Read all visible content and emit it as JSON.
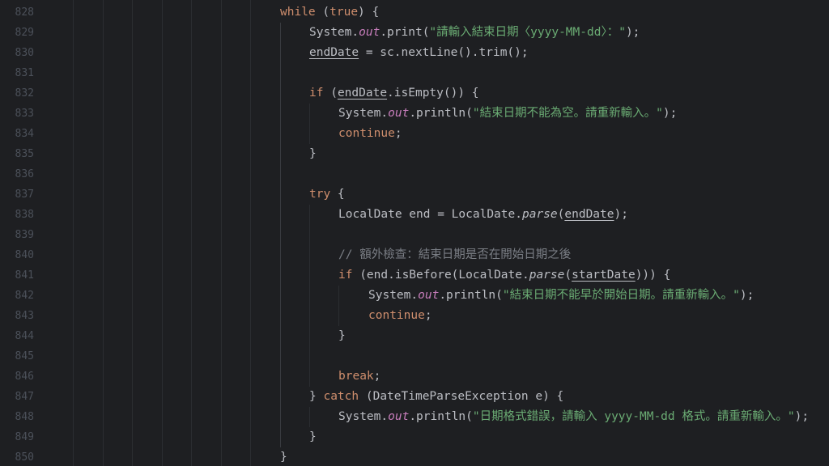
{
  "editor": {
    "lines": [
      {
        "num": "828",
        "tokens": [
          {
            "t": "while",
            "c": "kw"
          },
          {
            "t": " ("
          },
          {
            "t": "true",
            "c": "kw"
          },
          {
            "t": ") {"
          }
        ]
      },
      {
        "num": "829",
        "tokens": [
          {
            "t": "System."
          },
          {
            "t": "out",
            "c": "static"
          },
          {
            "t": ".print("
          },
          {
            "t": "\"請輸入結束日期〈yyyy-MM-dd〉：\"",
            "c": "str"
          },
          {
            "t": ");"
          }
        ]
      },
      {
        "num": "830",
        "tokens": [
          {
            "t": "endDate",
            "c": "ul"
          },
          {
            "t": " = sc.nextLine().trim();"
          }
        ]
      },
      {
        "num": "831",
        "tokens": []
      },
      {
        "num": "832",
        "tokens": [
          {
            "t": "if",
            "c": "kw"
          },
          {
            "t": " ("
          },
          {
            "t": "endDate",
            "c": "ul"
          },
          {
            "t": ".isEmpty()) {"
          }
        ]
      },
      {
        "num": "833",
        "tokens": [
          {
            "t": "System."
          },
          {
            "t": "out",
            "c": "static"
          },
          {
            "t": ".println("
          },
          {
            "t": "\"結束日期不能為空。請重新輸入。\"",
            "c": "str"
          },
          {
            "t": ");"
          }
        ]
      },
      {
        "num": "834",
        "tokens": [
          {
            "t": "continue",
            "c": "kw"
          },
          {
            "t": ";"
          }
        ]
      },
      {
        "num": "835",
        "tokens": [
          {
            "t": "}"
          }
        ]
      },
      {
        "num": "836",
        "tokens": []
      },
      {
        "num": "837",
        "tokens": [
          {
            "t": "try",
            "c": "kw"
          },
          {
            "t": " {"
          }
        ]
      },
      {
        "num": "838",
        "tokens": [
          {
            "t": "LocalDate end = LocalDate."
          },
          {
            "t": "parse",
            "c": "italic"
          },
          {
            "t": "("
          },
          {
            "t": "endDate",
            "c": "ul"
          },
          {
            "t": ");"
          }
        ]
      },
      {
        "num": "839",
        "tokens": []
      },
      {
        "num": "840",
        "tokens": [
          {
            "t": "// 額外檢查：結束日期是否在開始日期之後",
            "c": "cmt"
          }
        ]
      },
      {
        "num": "841",
        "tokens": [
          {
            "t": "if",
            "c": "kw"
          },
          {
            "t": " (end.isBefore(LocalDate."
          },
          {
            "t": "parse",
            "c": "italic"
          },
          {
            "t": "("
          },
          {
            "t": "startDate",
            "c": "ul"
          },
          {
            "t": "))) {"
          }
        ]
      },
      {
        "num": "842",
        "tokens": [
          {
            "t": "System."
          },
          {
            "t": "out",
            "c": "static"
          },
          {
            "t": ".println("
          },
          {
            "t": "\"結束日期不能早於開始日期。請重新輸入。\"",
            "c": "str"
          },
          {
            "t": ");"
          }
        ]
      },
      {
        "num": "843",
        "tokens": [
          {
            "t": "continue",
            "c": "kw"
          },
          {
            "t": ";"
          }
        ]
      },
      {
        "num": "844",
        "tokens": [
          {
            "t": "}"
          }
        ]
      },
      {
        "num": "845",
        "tokens": []
      },
      {
        "num": "846",
        "tokens": [
          {
            "t": "break",
            "c": "kw"
          },
          {
            "t": ";"
          }
        ]
      },
      {
        "num": "847",
        "tokens": [
          {
            "t": "} "
          },
          {
            "t": "catch",
            "c": "kw"
          },
          {
            "t": " (DateTimeParseException e) {"
          }
        ]
      },
      {
        "num": "848",
        "tokens": [
          {
            "t": "System."
          },
          {
            "t": "out",
            "c": "static"
          },
          {
            "t": ".println("
          },
          {
            "t": "\"日期格式錯誤，請輸入 yyyy-MM-dd 格式。請重新輸入。\"",
            "c": "str"
          },
          {
            "t": ");"
          }
        ]
      },
      {
        "num": "849",
        "tokens": [
          {
            "t": "}"
          }
        ]
      },
      {
        "num": "850",
        "tokens": [
          {
            "t": "}"
          }
        ]
      }
    ]
  }
}
